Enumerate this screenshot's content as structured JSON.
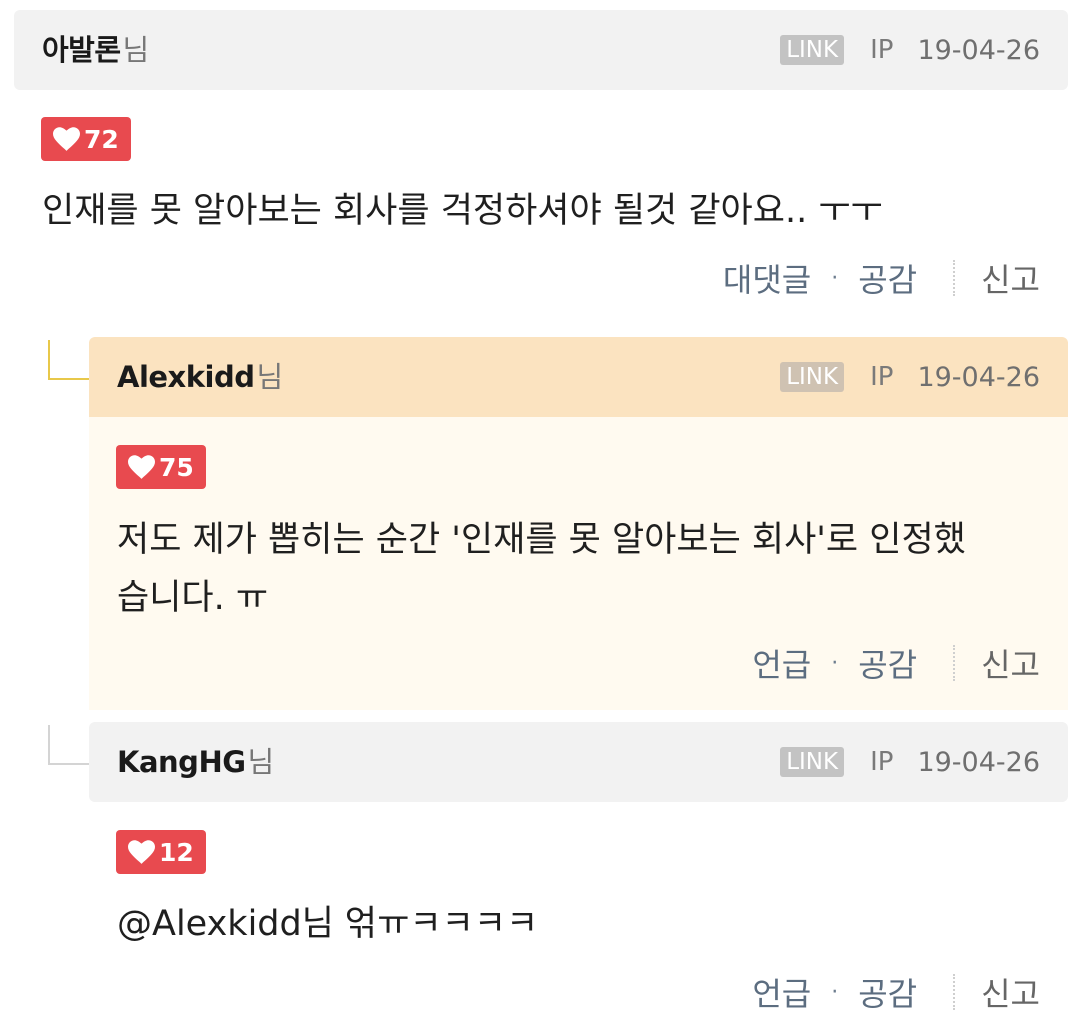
{
  "comments": [
    {
      "author": "아발론",
      "author_suffix": "님",
      "link_label": "LINK",
      "ip_label": "IP",
      "date": "19-04-26",
      "likes": "72",
      "text": "인재를 못 알아보는 회사를 걱정하셔야 될것 같아요.. ㅜㅜ",
      "actions": [
        "대댓글",
        "공감",
        "신고"
      ]
    },
    {
      "author": "Alexkidd",
      "author_suffix": "님",
      "link_label": "LINK",
      "ip_label": "IP",
      "date": "19-04-26",
      "likes": "75",
      "text_line1": "저도 제가 뽑히는 순간 '인재를 못 알아보는 회사'로 인정했",
      "text_line2": "습니다. ㅠ",
      "actions": [
        "언급",
        "공감",
        "신고"
      ]
    },
    {
      "author": "KangHG",
      "author_suffix": "님",
      "link_label": "LINK",
      "ip_label": "IP",
      "date": "19-04-26",
      "likes": "12",
      "text": "@Alexkidd님 얶ㅠㅋㅋㅋㅋ",
      "actions": [
        "언급",
        "공감",
        "신고"
      ]
    }
  ],
  "colors": {
    "like_badge": "#e84a4f",
    "highlight_header": "#fbe3c0",
    "highlight_body": "#fffaf0",
    "header": "#f2f2f2",
    "action_text": "#5c6d80"
  },
  "icons": {
    "like": "heart-icon"
  }
}
